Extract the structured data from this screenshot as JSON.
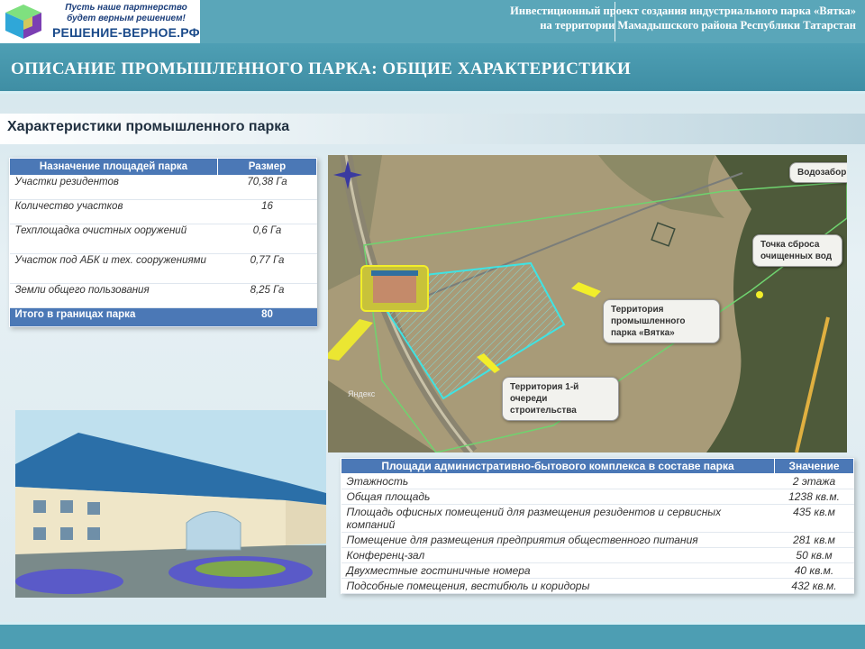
{
  "logo": {
    "slogan_line1": "Пусть наше партнерство",
    "slogan_line2": "будет верным решением!",
    "name": "РЕШЕНИЕ-ВЕРНОЕ.РФ"
  },
  "header": {
    "line1": "Инвестиционный проект создания индустриального парка «Вятка»",
    "line2": "на территории Мамадышского района Республики Татарстан"
  },
  "section_title": "ОПИСАНИЕ ПРОМЫШЛЕННОГО ПАРКА: ОБЩИЕ ХАРАКТЕРИСТИКИ",
  "subsection_title": "Характеристики промышленного парка",
  "park_table": {
    "headers": [
      "Назначение площадей парка",
      "Размер"
    ],
    "rows": [
      [
        "Участки резидентов",
        "70,38 Га"
      ],
      [
        "Количество участков",
        "16"
      ],
      [
        "Техплощадка очистных ооружений",
        "0,6 Га"
      ],
      [
        "Участок под АБК и тех. сооружениями",
        "0,77 Га"
      ],
      [
        "Земли общего пользования",
        "8,25 Га"
      ]
    ],
    "total": [
      "Итого в границах парка",
      "80"
    ]
  },
  "map": {
    "label_vodozabor": "Водозабор",
    "label_sbros": "Точка сброса очищенных вод",
    "label_territory": "Территория промышленного парка «Вятка»",
    "label_stage1": "Территория 1-й очереди строительства",
    "watermark": "Яндекс",
    "colors": {
      "boundary": "#6fd36f",
      "stage1": "#3fe3e3",
      "arrow": "#f2ee2a"
    }
  },
  "admin_table": {
    "headers": [
      "Площади административно-бытового комплекса в составе парка",
      "Значение"
    ],
    "rows": [
      [
        "Этажность",
        "2 этажа"
      ],
      [
        "Общая площадь",
        "1238 кв.м."
      ],
      [
        "Площадь офисных помещений для размещения резидентов и сервисных компаний",
        "435 кв.м"
      ],
      [
        "Помещение для размещения предприятия общественного питания",
        "281 кв.м"
      ],
      [
        "Конференц-зал",
        "50 кв.м"
      ],
      [
        "Двухместные гостиничные номера",
        "40 кв.м."
      ],
      [
        "Подсобные помещения, вестибюль и коридоры",
        "432 кв.м."
      ]
    ]
  },
  "icons": {
    "logo": "cube-logo-icon",
    "compass": "compass-icon",
    "building": "building-thumbnail-icon"
  }
}
